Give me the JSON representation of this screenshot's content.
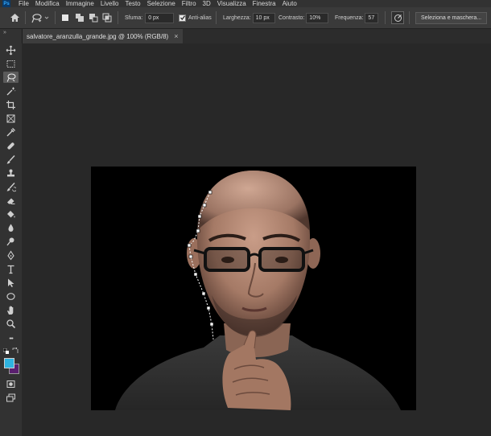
{
  "app": {
    "logo": "Ps"
  },
  "menu": [
    "File",
    "Modifica",
    "Immagine",
    "Livello",
    "Testo",
    "Selezione",
    "Filtro",
    "3D",
    "Visualizza",
    "Finestra",
    "Aiuto"
  ],
  "options": {
    "feather_label": "Sfuma:",
    "feather_value": "0 px",
    "antialias_label": "Anti-alias",
    "antialias_checked": true,
    "width_label": "Larghezza:",
    "width_value": "10 px",
    "contrast_label": "Contrasto:",
    "contrast_value": "10%",
    "frequency_label": "Frequenza:",
    "frequency_value": "57",
    "select_mask_label": "Seleziona e maschera..."
  },
  "document": {
    "tab_title": "salvatore_aranzulla_grande.jpg @ 100% (RGB/8)",
    "close_glyph": "×"
  },
  "toolbar": {
    "collapse_glyph": "»",
    "active_tool": "magnetic-lasso",
    "more_glyph": "•••",
    "foreground_color": "#2fb3e0",
    "background_color": "#5a1f6e"
  },
  "colors": {
    "app_bg": "#282828",
    "panel": "#323232",
    "options_bar": "#3a3a3a",
    "accent": "#31a8ff"
  }
}
